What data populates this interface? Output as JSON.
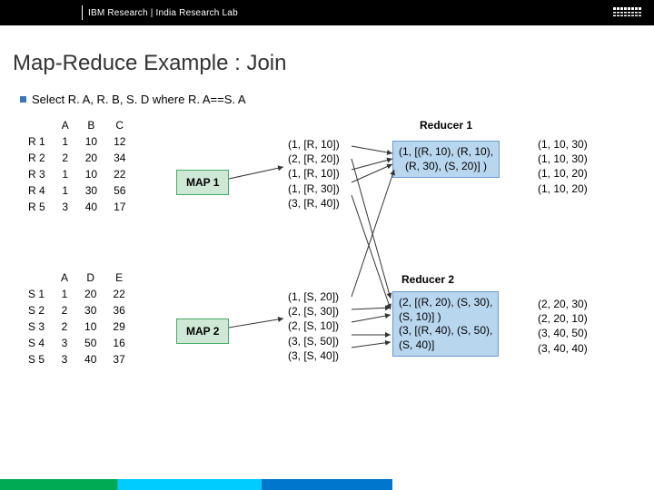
{
  "header": {
    "brand": "IBM Research  |  India Research Lab"
  },
  "title": "Map-Reduce Example : Join",
  "query": "Select R. A, R. B, S. D where R. A==S. A",
  "tableR": {
    "cols": [
      "",
      "A",
      "B",
      "C"
    ],
    "rows": [
      [
        "R 1",
        "1",
        "10",
        "12"
      ],
      [
        "R 2",
        "2",
        "20",
        "34"
      ],
      [
        "R 3",
        "1",
        "10",
        "22"
      ],
      [
        "R 4",
        "1",
        "30",
        "56"
      ],
      [
        "R 5",
        "3",
        "40",
        "17"
      ]
    ]
  },
  "tableS": {
    "cols": [
      "",
      "A",
      "D",
      "E"
    ],
    "rows": [
      [
        "S 1",
        "1",
        "20",
        "22"
      ],
      [
        "S 2",
        "2",
        "30",
        "36"
      ],
      [
        "S 3",
        "2",
        "10",
        "29"
      ],
      [
        "S 4",
        "3",
        "50",
        "16"
      ],
      [
        "S 5",
        "3",
        "40",
        "37"
      ]
    ]
  },
  "map1": "MAP 1",
  "map2": "MAP 2",
  "map1out": "(1, [R, 10])\n(2, [R, 20])\n(1, [R, 10])\n(1, [R, 30])\n(3, [R, 40])",
  "map2out": "(1, [S, 20])\n(2, [S, 30])\n(2, [S, 10])\n(3, [S, 50])\n(3, [S, 40])",
  "red1label": "Reducer 1",
  "red2label": "Reducer 2",
  "red1in": "(1, [(R, 10), (R, 10),\n(R, 30), (S, 20)] )",
  "red2in": "(2, [(R, 20), (S, 30),\n(S, 10)] )\n(3, [(R, 40), (S, 50),\n(S, 40)]",
  "out1": "(1, 10, 30)\n(1, 10, 30)\n(1, 10, 20)\n(1, 10, 20)",
  "out2": "(2, 20, 30)\n(2, 20, 10)\n(3, 40, 50)\n(3, 40, 40)"
}
